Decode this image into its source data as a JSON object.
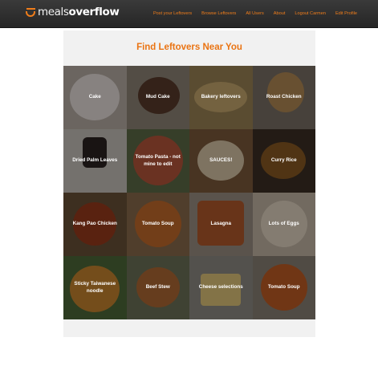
{
  "brand": {
    "part1": "meals",
    "part2": "overflow"
  },
  "nav": {
    "post": "Post your Leftovers",
    "browse": "Browse Leftovers",
    "users": "All Users",
    "about": "About",
    "logout": "Logout Carmen",
    "edit": "Edit Profile"
  },
  "main": {
    "title": "Find Leftovers Near You",
    "items": [
      {
        "label": "Cake"
      },
      {
        "label": "Mud Cake"
      },
      {
        "label": "Bakery leftovers"
      },
      {
        "label": "Roast Chicken"
      },
      {
        "label": "Dried Palm Leaves"
      },
      {
        "label": "Tomato Pasta - not mine to edit"
      },
      {
        "label": "SAUCES!"
      },
      {
        "label": "Curry Rice"
      },
      {
        "label": "Kang Pao Chicken"
      },
      {
        "label": "Tomato Soup"
      },
      {
        "label": "Lasagna"
      },
      {
        "label": "Lots of Eggs"
      },
      {
        "label": "Sticky Taiwanese noodle"
      },
      {
        "label": "Beef Stew"
      },
      {
        "label": "Cheese selections"
      },
      {
        "label": "Tomato Soup"
      }
    ]
  },
  "colors": {
    "accent": "#ea7413",
    "navbar": "#2e2e2e",
    "panel": "#f1f1f1"
  }
}
